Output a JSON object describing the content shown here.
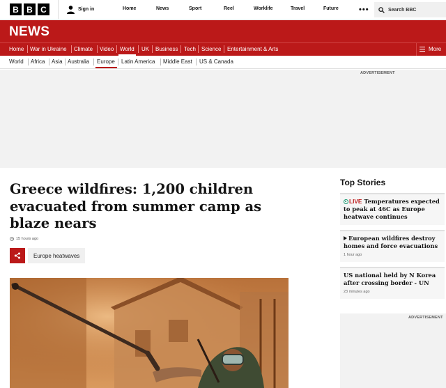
{
  "global_nav": {
    "logo_letters": [
      "B",
      "B",
      "C"
    ],
    "sign_in": "Sign in",
    "links": [
      "Home",
      "News",
      "Sport",
      "Reel",
      "Worklife",
      "Travel",
      "Future"
    ],
    "more": "•••",
    "search_placeholder": "Search BBC"
  },
  "news_header": {
    "title": "NEWS",
    "nav": [
      "Home",
      "War in Ukraine",
      "Climate",
      "Video",
      "World",
      "UK",
      "Business",
      "Tech",
      "Science",
      "Entertainment & Arts"
    ],
    "active": "World",
    "more": "More"
  },
  "sub_nav": {
    "items": [
      "World",
      "Africa",
      "Asia",
      "Australia",
      "Europe",
      "Latin America",
      "Middle East",
      "US & Canada"
    ],
    "active": "Europe"
  },
  "ads": {
    "top_label": "ADVERTISEMENT",
    "side_label": "ADVERTISEMENT"
  },
  "article": {
    "headline": "Greece wildfires: 1,200 children evacuated from summer camp as blaze nears",
    "timestamp": "15 hours ago",
    "topic": "Europe heatwaves"
  },
  "sidebar": {
    "title": "Top Stories",
    "stories": [
      {
        "badge": "LIVE",
        "title": "Temperatures expected to peak at 46C as Europe heatwave continues",
        "time": ""
      },
      {
        "badge": "",
        "title": "European wildfires destroy homes and force evacuations",
        "time": "1 hour ago"
      },
      {
        "badge": "",
        "title": "US national held by N Korea after crossing border - UN",
        "time": "23 minutes ago"
      }
    ]
  },
  "colors": {
    "brand_red": "#bb1919",
    "live_green": "#1a9a72"
  }
}
